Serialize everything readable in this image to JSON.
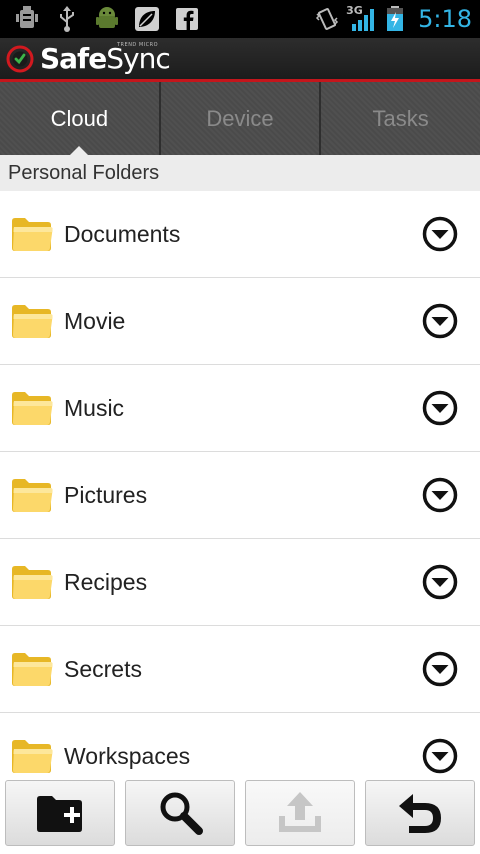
{
  "status_bar": {
    "time": "5:18",
    "network": "3G",
    "left_icons": [
      "debug-icon",
      "usb-icon",
      "android-icon",
      "leaf-icon",
      "facebook-icon"
    ],
    "right_icons": [
      "vibrate-icon",
      "signal-icon",
      "battery-charging-icon"
    ]
  },
  "app": {
    "name_bold": "Safe",
    "name_regular": "Sync",
    "vendor": "TREND MICRO",
    "accent_color": "#c4161c"
  },
  "tabs": [
    {
      "label": "Cloud",
      "active": true
    },
    {
      "label": "Device",
      "active": false
    },
    {
      "label": "Tasks",
      "active": false
    }
  ],
  "section": {
    "title": "Personal Folders"
  },
  "folders": [
    {
      "label": "Documents"
    },
    {
      "label": "Movie"
    },
    {
      "label": "Music"
    },
    {
      "label": "Pictures"
    },
    {
      "label": "Recipes"
    },
    {
      "label": "Secrets"
    },
    {
      "label": "Workspaces"
    }
  ],
  "toolbar": {
    "buttons": [
      {
        "name": "new-folder",
        "icon": "folder-plus-icon",
        "enabled": true
      },
      {
        "name": "search",
        "icon": "search-icon",
        "enabled": true
      },
      {
        "name": "upload",
        "icon": "upload-icon",
        "enabled": false
      },
      {
        "name": "back",
        "icon": "undo-icon",
        "enabled": true
      }
    ]
  }
}
